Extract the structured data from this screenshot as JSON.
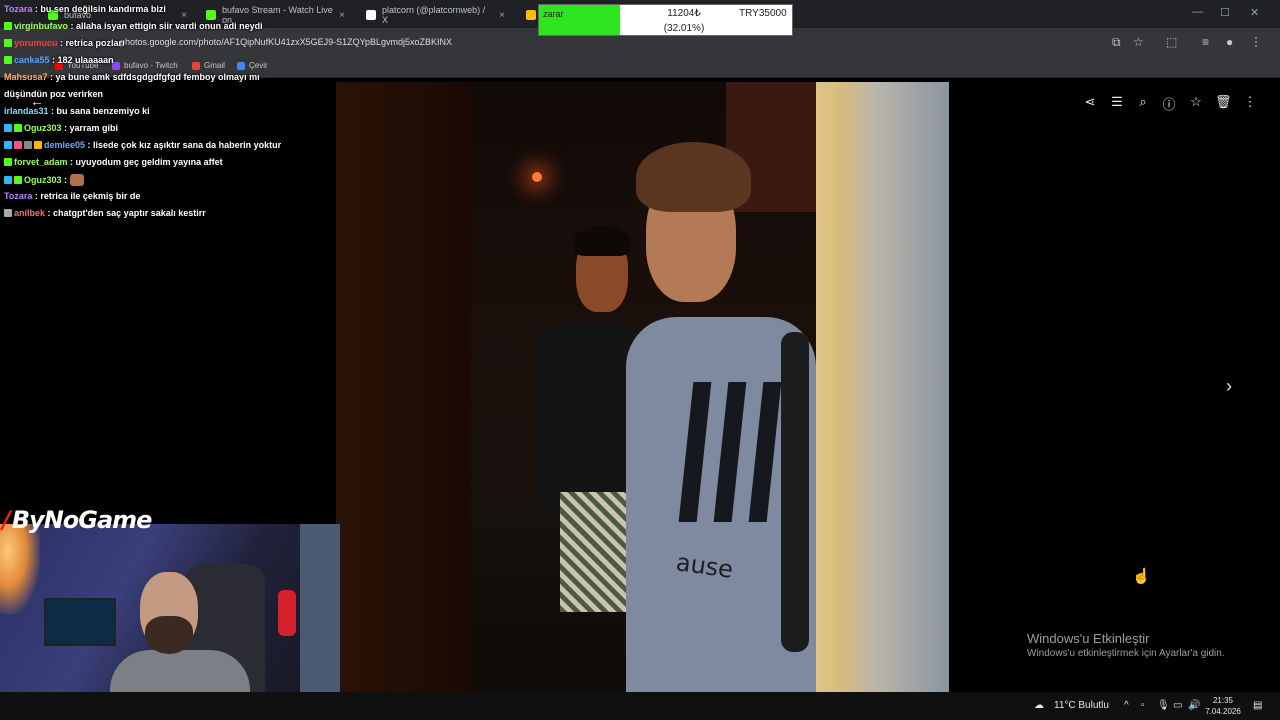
{
  "browser": {
    "tabs": [
      {
        "label": "bufavo",
        "color": "#53fc18"
      },
      {
        "label": "bufavo Stream - Watch Live on",
        "color": "#53fc18"
      },
      {
        "label": "platcorn (@platcornweb) / X",
        "color": "#ffffff"
      },
      {
        "label": "",
        "color": "#fbbc04"
      }
    ],
    "url": "photos.google.com/photo/AF1QipNufKU41zxX5GEJ9-S1ZQYpBLgvmdj5xoZBKINX",
    "bookmarks": [
      {
        "label": "YouTube",
        "color": "#ff0000"
      },
      {
        "label": "bufavo - Twitch",
        "color": "#9146ff"
      },
      {
        "label": "Gmail",
        "color": "#ea4335"
      },
      {
        "label": "Çevir",
        "color": "#4285f4"
      }
    ]
  },
  "goal": {
    "label": "zarar",
    "amount": "11204₺",
    "percent_text": "(32.01%)",
    "progress": 0.3201,
    "target": "TRY35000",
    "fill_color": "#2ee51f"
  },
  "chat": [
    {
      "user": "Tozara",
      "color": "#b683ff",
      "text": ": bu sen değilsin kandırma bizi",
      "badges": []
    },
    {
      "user": "virginbufavo",
      "color": "#9cff5a",
      "text": ": allaha isyan ettigin siir vardi onun adi neydi",
      "badges": [
        "#53fc18"
      ]
    },
    {
      "user": "yorumucu",
      "color": "#ff3b3b",
      "text": ": retrica pozları",
      "badges": [
        "#53fc18"
      ]
    },
    {
      "user": "canka55",
      "color": "#4fa3ff",
      "text": ": 182 ulaaaaan",
      "badges": [
        "#53fc18"
      ]
    },
    {
      "user": "Mahsusa7",
      "color": "#ffb347",
      "text": ": ya bune amk sdfdsgdgdfgfgd femboy olmayı mı",
      "badges": []
    },
    {
      "user": "",
      "color": "#ffffff",
      "text": "düşündün poz verirken",
      "badges": []
    },
    {
      "user": "irlandas31",
      "color": "#6fe0ff",
      "text": ": bu sana benzemiyo ki",
      "badges": []
    },
    {
      "user": "Oguz303",
      "color": "#9cff5a",
      "text": ": yarram gibi",
      "badges": [
        "#2db7ff",
        "#53fc18"
      ]
    },
    {
      "user": "demlee05",
      "color": "#6aa8ff",
      "text": ": lisede çok kız aşıktır sana da haberin yoktur",
      "badges": [
        "#2db7ff",
        "#ff4d88",
        "#888888",
        "#ffb800"
      ]
    },
    {
      "user": "forvet_adam",
      "color": "#9cff5a",
      "text": ": uyuyodum geç geldim yayına affet",
      "badges": [
        "#53fc18"
      ]
    },
    {
      "user": "Oguz303",
      "color": "#9cff5a",
      "text": ":",
      "badges": [
        "#2db7ff",
        "#53fc18"
      ],
      "emote": true
    },
    {
      "user": "Tozara",
      "color": "#b683ff",
      "text": ": retrica ile çekmiş bir de",
      "badges": []
    },
    {
      "user": "anilbek",
      "color": "#ff6a6a",
      "text": ": chatgpt'den saç yaptır sakalı kestirr",
      "badges": [
        "#aaaaaa"
      ]
    }
  ],
  "logo": {
    "text": "ByNoGame"
  },
  "viewer": {
    "toolbar_icons": [
      "share-icon",
      "edit-icon",
      "zoom-icon",
      "info-icon",
      "star-icon",
      "trash-icon",
      "more-icon"
    ],
    "shirt_text": "ause"
  },
  "activation": {
    "title": "Windows'u Etkinleştir",
    "subtitle": "Windows'u etkinleştirmek için Ayarlar'a gidin."
  },
  "taskbar": {
    "weather": "11°C  Bulutlu",
    "time": "21:35",
    "date": "7.04.2026"
  }
}
